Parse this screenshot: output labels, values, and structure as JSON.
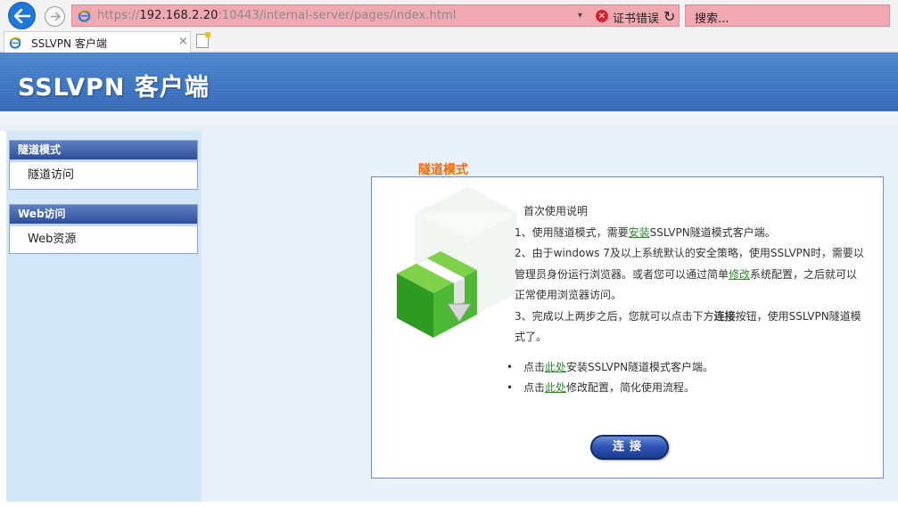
{
  "browser": {
    "url_prefix": "https://",
    "url_host": "192.168.2.20",
    "url_rest": ":10443/internal-server/pages/index.html",
    "dropdown_glyph": "▾",
    "cert_error": "证书错误",
    "search_placeholder": "搜索...",
    "tab_title": "SSLVPN 客户端",
    "tab_close": "×",
    "icons": [
      "back-arrow-icon",
      "forward-arrow-icon",
      "ie-favicon-icon",
      "certificate-error-icon",
      "refresh-icon",
      "new-tab-icon"
    ]
  },
  "header": {
    "title": "SSLVPN 客户端"
  },
  "sidebar": {
    "groups": [
      {
        "header": "隧道模式",
        "items": [
          {
            "label": "隧道访问"
          }
        ]
      },
      {
        "header": "Web访问",
        "items": [
          {
            "label": "Web资源"
          }
        ]
      }
    ]
  },
  "main": {
    "section_title": "隧道模式",
    "instructions": {
      "heading": "首次使用说明",
      "line1_before": "1、使用隧道模式，需要",
      "line1_link": "安装",
      "line1_after": "SSLVPN隧道模式客户端。",
      "line2_before": "2、由于windows 7及以上系统默认的安全策略，使用SSLVPN时，需要以管理员身份运行浏览器。或者您可以通过简单",
      "line2_link": "修改",
      "line2_after": "系统配置，之后就可以正常使用浏览器访问。",
      "line3_before": "3、完成以上两步之后，您就可以点击下方",
      "line3_strong": "连接",
      "line3_after": "按钮，使用SSLVPN隧道模式了。"
    },
    "bullets": [
      {
        "before": "点击",
        "link": "此处",
        "after": "安装SSLVPN隧道模式客户端。"
      },
      {
        "before": "点击",
        "link": "此处",
        "after": "修改配置，简化使用流程。"
      }
    ],
    "bullet_glyph": "•",
    "connect_button": "连接"
  },
  "colors": {
    "banner": "#3d74c2",
    "section_title": "#f46a0e",
    "link": "#2e8b2e",
    "sidebar_bg": "#d5e8f8",
    "url_bar_error": "#f1a9b1"
  }
}
